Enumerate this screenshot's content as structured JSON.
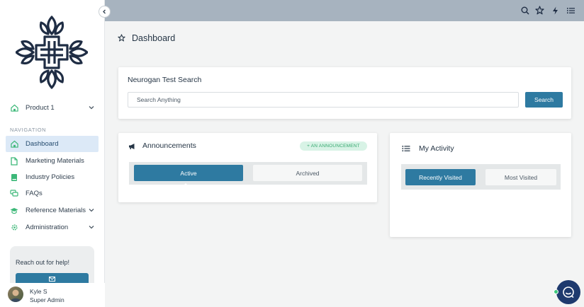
{
  "sidebar": {
    "product_selector": "Product 1",
    "nav_heading": "NAVIGATION",
    "items": [
      {
        "label": "Dashboard"
      },
      {
        "label": "Marketing Materials"
      },
      {
        "label": "Industry Policies"
      },
      {
        "label": "FAQs"
      },
      {
        "label": "Reference Materials"
      },
      {
        "label": "Administration"
      }
    ],
    "help_text": "Reach out for help!"
  },
  "user": {
    "name": "Kyle S",
    "role": "Super Admin"
  },
  "page": {
    "title": "Dashboard"
  },
  "search_card": {
    "title": "Neurogan Test Search",
    "placeholder": "Search Anything",
    "button": "Search"
  },
  "announcements": {
    "title": "Announcements",
    "add_label": "+ AN ANNOUNCEMENT",
    "tabs": [
      "Active",
      "Archived"
    ]
  },
  "activity": {
    "title": "My Activity",
    "tabs": [
      "Recently Visited",
      "Most Visited"
    ]
  },
  "colors": {
    "accent": "#2e7aa1",
    "topbar": "#a7b3bf",
    "nav_icon": "#3cb878",
    "logo": "#1f2d44"
  }
}
